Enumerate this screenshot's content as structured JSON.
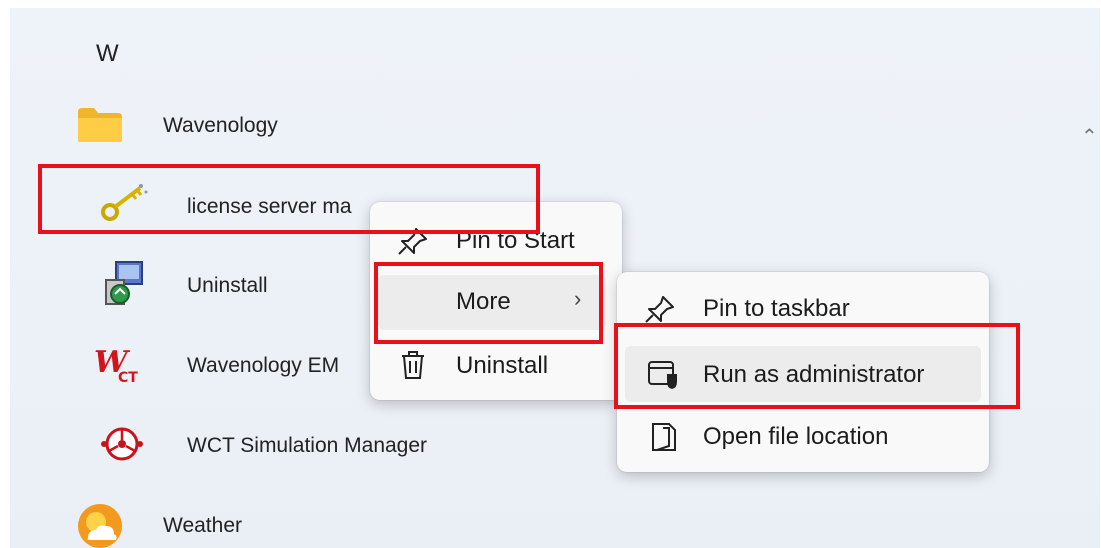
{
  "start_list": {
    "section_letter": "W",
    "collapse_icon": "chevron-up-icon",
    "items": [
      {
        "label": "Wavenology",
        "icon": "folder-icon"
      },
      {
        "label": "license server ma",
        "icon": "key-icon"
      },
      {
        "label": "Uninstall",
        "icon": "uninstall-app-icon"
      },
      {
        "label": "Wavenology EM",
        "icon": "wct-logo-icon"
      },
      {
        "label": "WCT Simulation Manager",
        "icon": "simulation-manager-icon"
      },
      {
        "label": "Weather",
        "icon": "weather-icon"
      }
    ]
  },
  "context_menu": {
    "items": [
      {
        "label": "Pin to Start",
        "icon": "pin-icon"
      },
      {
        "label": "More",
        "icon": "chevron-right-icon"
      },
      {
        "label": "Uninstall",
        "icon": "trash-icon"
      }
    ]
  },
  "submenu": {
    "items": [
      {
        "label": "Pin to taskbar",
        "icon": "pin-icon"
      },
      {
        "label": "Run as administrator",
        "icon": "admin-shield-icon"
      },
      {
        "label": "Open file location",
        "icon": "file-location-icon"
      }
    ]
  },
  "highlight_color": "#e8101a"
}
